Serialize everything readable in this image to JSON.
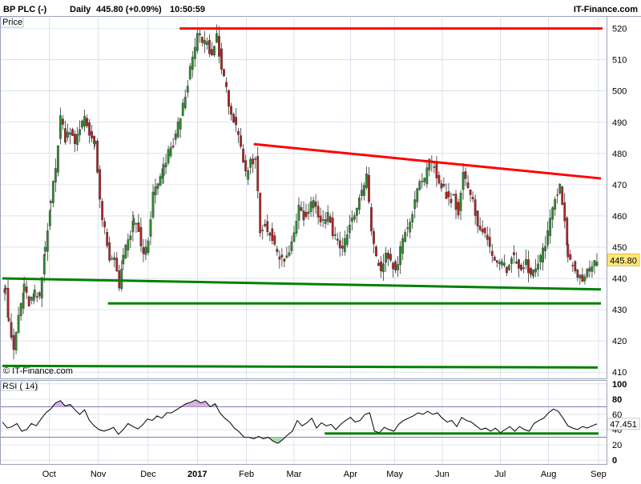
{
  "header": {
    "symbol": "BP PLC (-)",
    "period": "Daily",
    "last": "445.80 (+0.09%)",
    "time": "10:50:59",
    "brand": "IT-Finance.com"
  },
  "price_panel": {
    "label": "Price",
    "watermark": "© IT-Finance.com",
    "last_price_tag": "445.80"
  },
  "rsi_panel": {
    "label": "RSI ( 14)",
    "value_tag": "47.451"
  },
  "colors": {
    "up": "#2e8b2e",
    "down": "#b22222",
    "resistance": "#ff0000",
    "support": "#008000",
    "rsi_line": "#000000",
    "rsi_band": "#c8a0d8",
    "grid": "#c8d0e0"
  },
  "chart_data": [
    {
      "type": "candlestick",
      "title": "BP PLC (-) Daily",
      "yticks": [
        410,
        420,
        430,
        440,
        450,
        460,
        470,
        480,
        490,
        500,
        510,
        520
      ],
      "ylim": [
        408,
        524
      ],
      "xticks": [
        "Oct",
        "Nov",
        "Dec",
        "2017",
        "Feb",
        "Mar",
        "Apr",
        "May",
        "Jun",
        "Jul",
        "Aug",
        "Sep"
      ],
      "grid": true,
      "last_value": 445.8,
      "path": [
        {
          "t": 0,
          "v": 436
        },
        {
          "t": 4,
          "v": 437
        },
        {
          "t": 8,
          "v": 425
        },
        {
          "t": 14,
          "v": 417
        },
        {
          "t": 20,
          "v": 428
        },
        {
          "t": 27,
          "v": 437
        },
        {
          "t": 33,
          "v": 432
        },
        {
          "t": 40,
          "v": 435
        },
        {
          "t": 46,
          "v": 433
        },
        {
          "t": 53,
          "v": 450
        },
        {
          "t": 60,
          "v": 465
        },
        {
          "t": 66,
          "v": 475
        },
        {
          "t": 72,
          "v": 492
        },
        {
          "t": 78,
          "v": 485
        },
        {
          "t": 84,
          "v": 488
        },
        {
          "t": 90,
          "v": 484
        },
        {
          "t": 96,
          "v": 487
        },
        {
          "t": 102,
          "v": 492
        },
        {
          "t": 108,
          "v": 486
        },
        {
          "t": 115,
          "v": 484
        },
        {
          "t": 121,
          "v": 464
        },
        {
          "t": 127,
          "v": 455
        },
        {
          "t": 133,
          "v": 445
        },
        {
          "t": 139,
          "v": 447
        },
        {
          "t": 145,
          "v": 438
        },
        {
          "t": 150,
          "v": 447
        },
        {
          "t": 156,
          "v": 452
        },
        {
          "t": 163,
          "v": 458
        },
        {
          "t": 169,
          "v": 455
        },
        {
          "t": 175,
          "v": 447
        },
        {
          "t": 181,
          "v": 452
        },
        {
          "t": 187,
          "v": 467
        },
        {
          "t": 193,
          "v": 470
        },
        {
          "t": 200,
          "v": 475
        },
        {
          "t": 206,
          "v": 480
        },
        {
          "t": 212,
          "v": 483
        },
        {
          "t": 218,
          "v": 489
        },
        {
          "t": 224,
          "v": 495
        },
        {
          "t": 230,
          "v": 503
        },
        {
          "t": 236,
          "v": 510
        },
        {
          "t": 242,
          "v": 518
        },
        {
          "t": 248,
          "v": 516
        },
        {
          "t": 254,
          "v": 515
        },
        {
          "t": 260,
          "v": 511
        },
        {
          "t": 266,
          "v": 518
        },
        {
          "t": 272,
          "v": 507
        },
        {
          "t": 278,
          "v": 500
        },
        {
          "t": 284,
          "v": 493
        },
        {
          "t": 290,
          "v": 488
        },
        {
          "t": 296,
          "v": 481
        },
        {
          "t": 302,
          "v": 473
        },
        {
          "t": 308,
          "v": 477
        },
        {
          "t": 314,
          "v": 479
        },
        {
          "t": 320,
          "v": 455
        },
        {
          "t": 326,
          "v": 457
        },
        {
          "t": 332,
          "v": 455
        },
        {
          "t": 338,
          "v": 450
        },
        {
          "t": 344,
          "v": 446
        },
        {
          "t": 350,
          "v": 446
        },
        {
          "t": 356,
          "v": 448
        },
        {
          "t": 362,
          "v": 455
        },
        {
          "t": 368,
          "v": 464
        },
        {
          "t": 374,
          "v": 460
        },
        {
          "t": 380,
          "v": 462
        },
        {
          "t": 386,
          "v": 466
        },
        {
          "t": 392,
          "v": 460
        },
        {
          "t": 398,
          "v": 458
        },
        {
          "t": 404,
          "v": 461
        },
        {
          "t": 410,
          "v": 455
        },
        {
          "t": 416,
          "v": 452
        },
        {
          "t": 422,
          "v": 449
        },
        {
          "t": 428,
          "v": 455
        },
        {
          "t": 434,
          "v": 459
        },
        {
          "t": 440,
          "v": 463
        },
        {
          "t": 446,
          "v": 467
        },
        {
          "t": 452,
          "v": 473
        },
        {
          "t": 458,
          "v": 455
        },
        {
          "t": 464,
          "v": 446
        },
        {
          "t": 470,
          "v": 443
        },
        {
          "t": 476,
          "v": 447
        },
        {
          "t": 482,
          "v": 446
        },
        {
          "t": 488,
          "v": 442
        },
        {
          "t": 494,
          "v": 449
        },
        {
          "t": 500,
          "v": 455
        },
        {
          "t": 506,
          "v": 457
        },
        {
          "t": 512,
          "v": 465
        },
        {
          "t": 518,
          "v": 472
        },
        {
          "t": 524,
          "v": 471
        },
        {
          "t": 530,
          "v": 477
        },
        {
          "t": 536,
          "v": 476
        },
        {
          "t": 542,
          "v": 470
        },
        {
          "t": 548,
          "v": 469
        },
        {
          "t": 554,
          "v": 465
        },
        {
          "t": 560,
          "v": 466
        },
        {
          "t": 566,
          "v": 461
        },
        {
          "t": 572,
          "v": 474
        },
        {
          "t": 578,
          "v": 468
        },
        {
          "t": 584,
          "v": 464
        },
        {
          "t": 590,
          "v": 458
        },
        {
          "t": 596,
          "v": 455
        },
        {
          "t": 602,
          "v": 452
        },
        {
          "t": 608,
          "v": 448
        },
        {
          "t": 614,
          "v": 446
        },
        {
          "t": 620,
          "v": 444
        },
        {
          "t": 626,
          "v": 443
        },
        {
          "t": 632,
          "v": 447
        },
        {
          "t": 638,
          "v": 445
        },
        {
          "t": 644,
          "v": 442
        },
        {
          "t": 650,
          "v": 445
        },
        {
          "t": 656,
          "v": 441
        },
        {
          "t": 662,
          "v": 443
        },
        {
          "t": 668,
          "v": 446
        },
        {
          "t": 674,
          "v": 451
        },
        {
          "t": 680,
          "v": 458
        },
        {
          "t": 686,
          "v": 466
        },
        {
          "t": 692,
          "v": 470
        },
        {
          "t": 698,
          "v": 458
        },
        {
          "t": 702,
          "v": 447
        },
        {
          "t": 708,
          "v": 444
        },
        {
          "t": 714,
          "v": 441
        },
        {
          "t": 720,
          "v": 440
        },
        {
          "t": 726,
          "v": 443
        },
        {
          "t": 732,
          "v": 444
        },
        {
          "t": 738,
          "v": 446
        }
      ],
      "trendlines": [
        {
          "kind": "resistance",
          "from": {
            "t": 220,
            "v": 520
          },
          "to": {
            "t": 745,
            "v": 520
          }
        },
        {
          "kind": "resistance",
          "from": {
            "t": 312,
            "v": 483
          },
          "to": {
            "t": 743,
            "v": 472
          }
        },
        {
          "kind": "support",
          "from": {
            "t": 0,
            "v": 440
          },
          "to": {
            "t": 743,
            "v": 436.5
          }
        },
        {
          "kind": "support",
          "from": {
            "t": 131,
            "v": 432
          },
          "to": {
            "t": 743,
            "v": 432
          }
        },
        {
          "kind": "support",
          "from": {
            "t": 0,
            "v": 412
          },
          "to": {
            "t": 739,
            "v": 411.5
          }
        }
      ]
    },
    {
      "type": "line",
      "title": "RSI ( 14)",
      "yticks": [
        0,
        20,
        40,
        60,
        80,
        100
      ],
      "ylim": [
        -5,
        105
      ],
      "grid": true,
      "bands": [
        30,
        70
      ],
      "last_value": 47.451,
      "series": [
        {
          "name": "RSI ( 14)",
          "points": [
            {
              "t": 0,
              "v": 50
            },
            {
              "t": 6,
              "v": 42
            },
            {
              "t": 12,
              "v": 44
            },
            {
              "t": 18,
              "v": 48
            },
            {
              "t": 24,
              "v": 38
            },
            {
              "t": 30,
              "v": 40
            },
            {
              "t": 36,
              "v": 48
            },
            {
              "t": 42,
              "v": 45
            },
            {
              "t": 48,
              "v": 54
            },
            {
              "t": 54,
              "v": 62
            },
            {
              "t": 60,
              "v": 67
            },
            {
              "t": 66,
              "v": 75
            },
            {
              "t": 72,
              "v": 78
            },
            {
              "t": 78,
              "v": 71
            },
            {
              "t": 84,
              "v": 73
            },
            {
              "t": 90,
              "v": 66
            },
            {
              "t": 96,
              "v": 60
            },
            {
              "t": 102,
              "v": 66
            },
            {
              "t": 108,
              "v": 52
            },
            {
              "t": 114,
              "v": 45
            },
            {
              "t": 120,
              "v": 40
            },
            {
              "t": 126,
              "v": 38
            },
            {
              "t": 132,
              "v": 40
            },
            {
              "t": 138,
              "v": 43
            },
            {
              "t": 144,
              "v": 34
            },
            {
              "t": 150,
              "v": 40
            },
            {
              "t": 156,
              "v": 48
            },
            {
              "t": 162,
              "v": 44
            },
            {
              "t": 168,
              "v": 41
            },
            {
              "t": 174,
              "v": 46
            },
            {
              "t": 180,
              "v": 54
            },
            {
              "t": 186,
              "v": 52
            },
            {
              "t": 192,
              "v": 58
            },
            {
              "t": 198,
              "v": 55
            },
            {
              "t": 204,
              "v": 62
            },
            {
              "t": 210,
              "v": 62
            },
            {
              "t": 216,
              "v": 66
            },
            {
              "t": 222,
              "v": 70
            },
            {
              "t": 228,
              "v": 74
            },
            {
              "t": 234,
              "v": 76
            },
            {
              "t": 240,
              "v": 79
            },
            {
              "t": 246,
              "v": 75
            },
            {
              "t": 252,
              "v": 77
            },
            {
              "t": 258,
              "v": 70
            },
            {
              "t": 264,
              "v": 74
            },
            {
              "t": 270,
              "v": 62
            },
            {
              "t": 276,
              "v": 55
            },
            {
              "t": 282,
              "v": 50
            },
            {
              "t": 288,
              "v": 42
            },
            {
              "t": 294,
              "v": 37
            },
            {
              "t": 300,
              "v": 30
            },
            {
              "t": 306,
              "v": 30
            },
            {
              "t": 312,
              "v": 28
            },
            {
              "t": 318,
              "v": 31
            },
            {
              "t": 324,
              "v": 28
            },
            {
              "t": 330,
              "v": 30
            },
            {
              "t": 336,
              "v": 25
            },
            {
              "t": 342,
              "v": 22
            },
            {
              "t": 348,
              "v": 27
            },
            {
              "t": 354,
              "v": 33
            },
            {
              "t": 360,
              "v": 38
            },
            {
              "t": 366,
              "v": 52
            },
            {
              "t": 372,
              "v": 45
            },
            {
              "t": 378,
              "v": 49
            },
            {
              "t": 384,
              "v": 55
            },
            {
              "t": 390,
              "v": 42
            },
            {
              "t": 396,
              "v": 49
            },
            {
              "t": 402,
              "v": 45
            },
            {
              "t": 408,
              "v": 47
            },
            {
              "t": 414,
              "v": 40
            },
            {
              "t": 420,
              "v": 47
            },
            {
              "t": 426,
              "v": 52
            },
            {
              "t": 432,
              "v": 56
            },
            {
              "t": 438,
              "v": 50
            },
            {
              "t": 444,
              "v": 52
            },
            {
              "t": 450,
              "v": 60
            },
            {
              "t": 456,
              "v": 62
            },
            {
              "t": 462,
              "v": 38
            },
            {
              "t": 468,
              "v": 36
            },
            {
              "t": 474,
              "v": 43
            },
            {
              "t": 480,
              "v": 40
            },
            {
              "t": 486,
              "v": 38
            },
            {
              "t": 492,
              "v": 47
            },
            {
              "t": 498,
              "v": 52
            },
            {
              "t": 504,
              "v": 55
            },
            {
              "t": 510,
              "v": 58
            },
            {
              "t": 516,
              "v": 62
            },
            {
              "t": 522,
              "v": 60
            },
            {
              "t": 528,
              "v": 64
            },
            {
              "t": 534,
              "v": 60
            },
            {
              "t": 540,
              "v": 62
            },
            {
              "t": 546,
              "v": 55
            },
            {
              "t": 552,
              "v": 50
            },
            {
              "t": 558,
              "v": 52
            },
            {
              "t": 564,
              "v": 44
            },
            {
              "t": 570,
              "v": 56
            },
            {
              "t": 576,
              "v": 52
            },
            {
              "t": 582,
              "v": 50
            },
            {
              "t": 588,
              "v": 45
            },
            {
              "t": 594,
              "v": 40
            },
            {
              "t": 600,
              "v": 42
            },
            {
              "t": 606,
              "v": 38
            },
            {
              "t": 612,
              "v": 42
            },
            {
              "t": 618,
              "v": 36
            },
            {
              "t": 624,
              "v": 40
            },
            {
              "t": 630,
              "v": 44
            },
            {
              "t": 636,
              "v": 38
            },
            {
              "t": 642,
              "v": 44
            },
            {
              "t": 648,
              "v": 40
            },
            {
              "t": 654,
              "v": 38
            },
            {
              "t": 660,
              "v": 48
            },
            {
              "t": 666,
              "v": 52
            },
            {
              "t": 672,
              "v": 55
            },
            {
              "t": 678,
              "v": 62
            },
            {
              "t": 684,
              "v": 67
            },
            {
              "t": 690,
              "v": 64
            },
            {
              "t": 696,
              "v": 55
            },
            {
              "t": 702,
              "v": 45
            },
            {
              "t": 708,
              "v": 42
            },
            {
              "t": 714,
              "v": 40
            },
            {
              "t": 720,
              "v": 44
            },
            {
              "t": 726,
              "v": 42
            },
            {
              "t": 732,
              "v": 45
            },
            {
              "t": 738,
              "v": 47.451
            }
          ]
        }
      ],
      "trendlines": [
        {
          "kind": "support",
          "from": {
            "t": 400,
            "v": 35
          },
          "to": {
            "t": 740,
            "v": 35
          }
        }
      ]
    }
  ]
}
